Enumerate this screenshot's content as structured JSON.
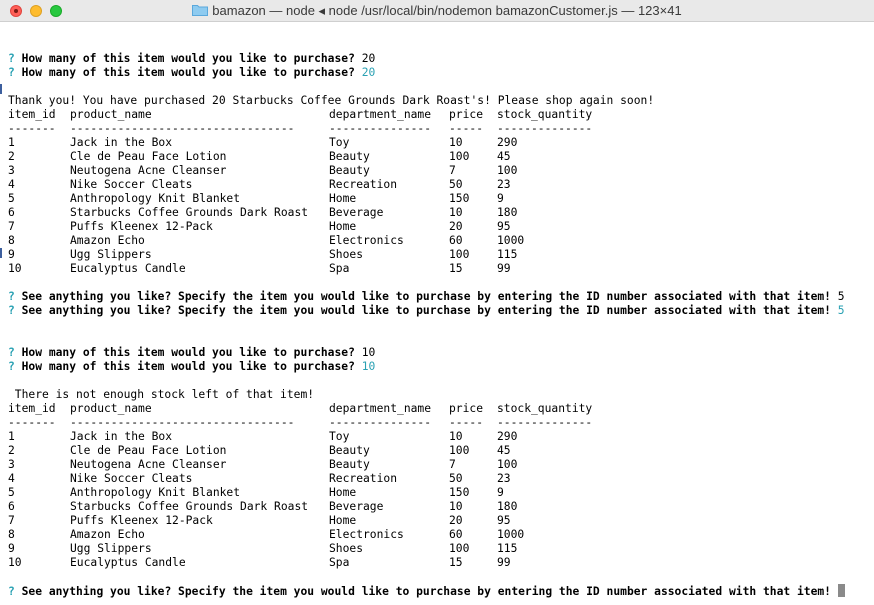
{
  "window": {
    "title": "bamazon — node ◂ node /usr/local/bin/nodemon bamazonCustomer.js — 123×41"
  },
  "prompt_marker": "?",
  "questions": {
    "qty": "How many of this item would you like to purchase?",
    "item": "See anything you like? Specify the item you would like to purchase by entering the ID number associated with that item!"
  },
  "answers": {
    "qty1_typed": "20",
    "qty1_final": "20",
    "item_typed": "5",
    "item_final": "5",
    "qty2_typed": "10",
    "qty2_final": "10"
  },
  "messages": {
    "thanks": "Thank you! You have purchased 20 Starbucks Coffee Grounds Dark Roast's! Please shop again soon!",
    "not_enough": " There is not enough stock left of that item!"
  },
  "table": {
    "headers": [
      "item_id",
      "product_name",
      "department_name",
      "price",
      "stock_quantity"
    ],
    "dashes": [
      "-------",
      "---------------------------------",
      "---------------",
      "-----",
      "--------------"
    ],
    "rows": [
      [
        "1",
        "Jack in the Box",
        "Toy",
        "10",
        "290"
      ],
      [
        "2",
        "Cle de Peau Face Lotion",
        "Beauty",
        "100",
        "45"
      ],
      [
        "3",
        "Neutogena Acne Cleanser",
        "Beauty",
        "7",
        "100"
      ],
      [
        "4",
        "Nike Soccer Cleats",
        "Recreation",
        "50",
        "23"
      ],
      [
        "5",
        "Anthropology Knit Blanket",
        "Home",
        "150",
        "9"
      ],
      [
        "6",
        "Starbucks Coffee Grounds Dark Roast",
        "Beverage",
        "10",
        "180"
      ],
      [
        "7",
        "Puffs Kleenex 12-Pack",
        "Home",
        "20",
        "95"
      ],
      [
        "8",
        "Amazon Echo",
        "Electronics",
        "60",
        "1000"
      ],
      [
        "9",
        "Ugg Slippers",
        "Shoes",
        "100",
        "115"
      ],
      [
        "10",
        "Eucalyptus Candle",
        "Spa",
        "15",
        "99"
      ]
    ]
  }
}
